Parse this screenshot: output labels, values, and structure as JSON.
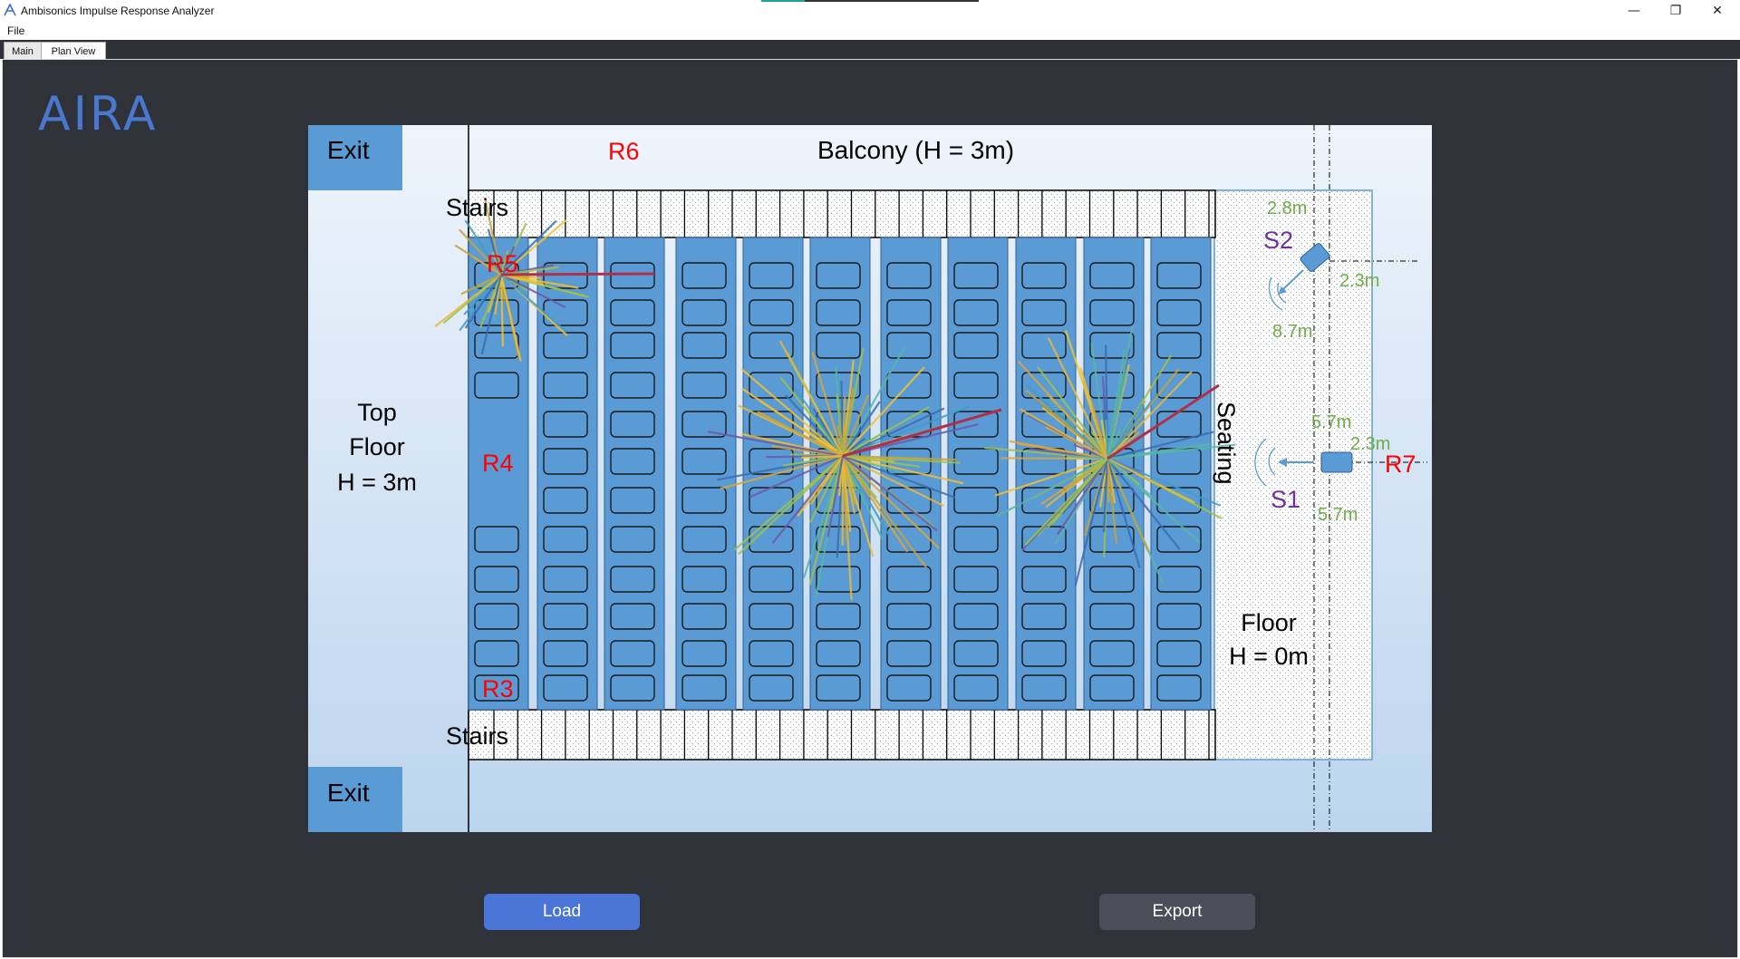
{
  "window": {
    "title": "Ambisonics Impulse Response Analyzer",
    "minimize": "—",
    "restore": "❐",
    "close": "✕",
    "progress_fraction": 0.2
  },
  "menu": {
    "file": "File"
  },
  "tabs": [
    {
      "label": "Main"
    },
    {
      "label": "Plan View"
    }
  ],
  "logo": {
    "text": "AIRA",
    "color": "#4a78cf"
  },
  "plan": {
    "exit_top": "Exit",
    "exit_bottom": "Exit",
    "balcony": "Balcony (H = 3m)",
    "stairs_top": "Stairs",
    "stairs_bottom": "Stairs",
    "top_floor_line1": "Top",
    "top_floor_line2": "Floor",
    "top_floor_line3": "H = 3m",
    "seating": "Seating",
    "floor_line1": "Floor",
    "floor_line2": "H = 0m",
    "receivers": {
      "r6": "R6",
      "r5": "R5",
      "r4": "R4",
      "r3": "R3",
      "r7": "R7"
    },
    "sources": {
      "s1": "S1",
      "s2": "S2"
    },
    "dims": {
      "s2_top": "2.8m",
      "s2_right": "2.3m",
      "s2_bottom": "8.7m",
      "s1_top": "5.7m",
      "s1_right": "2.3m",
      "s1_bottom": "5.7m"
    },
    "colors": {
      "panel_bg_top": "#eef4fb",
      "panel_bg_bottom": "#bcd5ee",
      "block_blue": "#5b9bd5",
      "label_red": "#ff0000",
      "source_purple": "#7030a0",
      "dim_green": "#70ad47"
    }
  },
  "buttons": {
    "load": "Load",
    "export": "Export"
  }
}
